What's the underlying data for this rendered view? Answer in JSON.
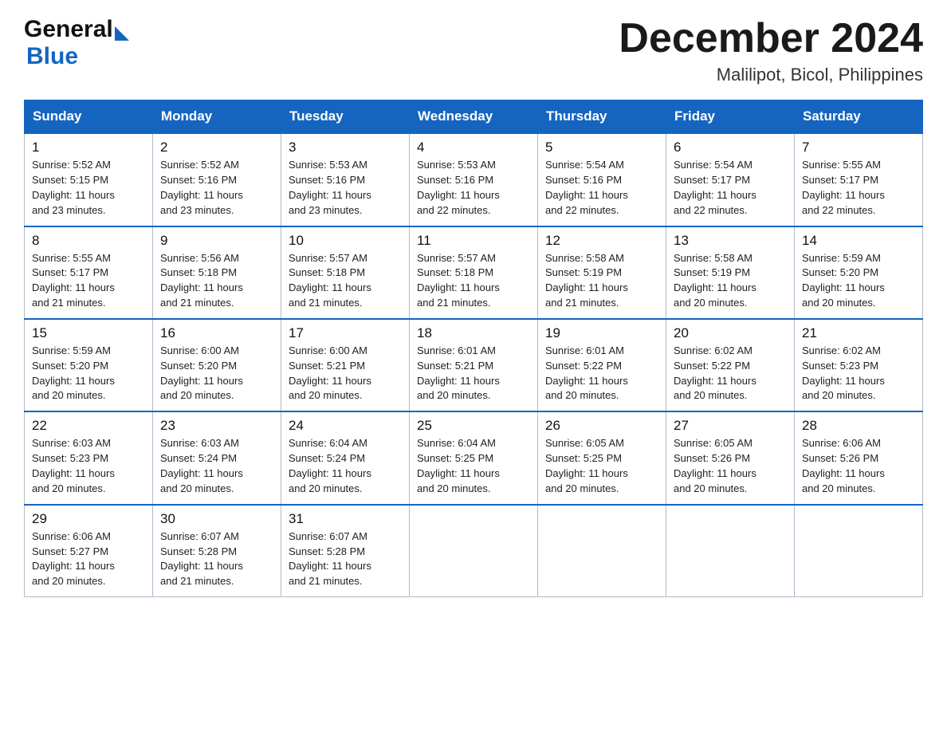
{
  "header": {
    "logo_general": "General",
    "logo_blue": "Blue",
    "month_title": "December 2024",
    "location": "Malilipot, Bicol, Philippines"
  },
  "days_of_week": [
    "Sunday",
    "Monday",
    "Tuesday",
    "Wednesday",
    "Thursday",
    "Friday",
    "Saturday"
  ],
  "weeks": [
    [
      {
        "day": "1",
        "sunrise": "5:52 AM",
        "sunset": "5:15 PM",
        "daylight": "11 hours and 23 minutes."
      },
      {
        "day": "2",
        "sunrise": "5:52 AM",
        "sunset": "5:16 PM",
        "daylight": "11 hours and 23 minutes."
      },
      {
        "day": "3",
        "sunrise": "5:53 AM",
        "sunset": "5:16 PM",
        "daylight": "11 hours and 23 minutes."
      },
      {
        "day": "4",
        "sunrise": "5:53 AM",
        "sunset": "5:16 PM",
        "daylight": "11 hours and 22 minutes."
      },
      {
        "day": "5",
        "sunrise": "5:54 AM",
        "sunset": "5:16 PM",
        "daylight": "11 hours and 22 minutes."
      },
      {
        "day": "6",
        "sunrise": "5:54 AM",
        "sunset": "5:17 PM",
        "daylight": "11 hours and 22 minutes."
      },
      {
        "day": "7",
        "sunrise": "5:55 AM",
        "sunset": "5:17 PM",
        "daylight": "11 hours and 22 minutes."
      }
    ],
    [
      {
        "day": "8",
        "sunrise": "5:55 AM",
        "sunset": "5:17 PM",
        "daylight": "11 hours and 21 minutes."
      },
      {
        "day": "9",
        "sunrise": "5:56 AM",
        "sunset": "5:18 PM",
        "daylight": "11 hours and 21 minutes."
      },
      {
        "day": "10",
        "sunrise": "5:57 AM",
        "sunset": "5:18 PM",
        "daylight": "11 hours and 21 minutes."
      },
      {
        "day": "11",
        "sunrise": "5:57 AM",
        "sunset": "5:18 PM",
        "daylight": "11 hours and 21 minutes."
      },
      {
        "day": "12",
        "sunrise": "5:58 AM",
        "sunset": "5:19 PM",
        "daylight": "11 hours and 21 minutes."
      },
      {
        "day": "13",
        "sunrise": "5:58 AM",
        "sunset": "5:19 PM",
        "daylight": "11 hours and 20 minutes."
      },
      {
        "day": "14",
        "sunrise": "5:59 AM",
        "sunset": "5:20 PM",
        "daylight": "11 hours and 20 minutes."
      }
    ],
    [
      {
        "day": "15",
        "sunrise": "5:59 AM",
        "sunset": "5:20 PM",
        "daylight": "11 hours and 20 minutes."
      },
      {
        "day": "16",
        "sunrise": "6:00 AM",
        "sunset": "5:20 PM",
        "daylight": "11 hours and 20 minutes."
      },
      {
        "day": "17",
        "sunrise": "6:00 AM",
        "sunset": "5:21 PM",
        "daylight": "11 hours and 20 minutes."
      },
      {
        "day": "18",
        "sunrise": "6:01 AM",
        "sunset": "5:21 PM",
        "daylight": "11 hours and 20 minutes."
      },
      {
        "day": "19",
        "sunrise": "6:01 AM",
        "sunset": "5:22 PM",
        "daylight": "11 hours and 20 minutes."
      },
      {
        "day": "20",
        "sunrise": "6:02 AM",
        "sunset": "5:22 PM",
        "daylight": "11 hours and 20 minutes."
      },
      {
        "day": "21",
        "sunrise": "6:02 AM",
        "sunset": "5:23 PM",
        "daylight": "11 hours and 20 minutes."
      }
    ],
    [
      {
        "day": "22",
        "sunrise": "6:03 AM",
        "sunset": "5:23 PM",
        "daylight": "11 hours and 20 minutes."
      },
      {
        "day": "23",
        "sunrise": "6:03 AM",
        "sunset": "5:24 PM",
        "daylight": "11 hours and 20 minutes."
      },
      {
        "day": "24",
        "sunrise": "6:04 AM",
        "sunset": "5:24 PM",
        "daylight": "11 hours and 20 minutes."
      },
      {
        "day": "25",
        "sunrise": "6:04 AM",
        "sunset": "5:25 PM",
        "daylight": "11 hours and 20 minutes."
      },
      {
        "day": "26",
        "sunrise": "6:05 AM",
        "sunset": "5:25 PM",
        "daylight": "11 hours and 20 minutes."
      },
      {
        "day": "27",
        "sunrise": "6:05 AM",
        "sunset": "5:26 PM",
        "daylight": "11 hours and 20 minutes."
      },
      {
        "day": "28",
        "sunrise": "6:06 AM",
        "sunset": "5:26 PM",
        "daylight": "11 hours and 20 minutes."
      }
    ],
    [
      {
        "day": "29",
        "sunrise": "6:06 AM",
        "sunset": "5:27 PM",
        "daylight": "11 hours and 20 minutes."
      },
      {
        "day": "30",
        "sunrise": "6:07 AM",
        "sunset": "5:28 PM",
        "daylight": "11 hours and 21 minutes."
      },
      {
        "day": "31",
        "sunrise": "6:07 AM",
        "sunset": "5:28 PM",
        "daylight": "11 hours and 21 minutes."
      },
      null,
      null,
      null,
      null
    ]
  ],
  "labels": {
    "sunrise": "Sunrise:",
    "sunset": "Sunset:",
    "daylight": "Daylight:"
  }
}
